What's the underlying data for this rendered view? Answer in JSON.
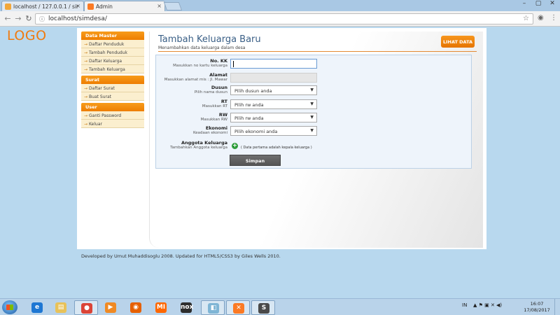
{
  "browser": {
    "tabs": [
      {
        "title": "localhost / 127.0.0.1 / sir",
        "close": "×",
        "active": false
      },
      {
        "title": "Admin",
        "close": "×",
        "active": true
      }
    ],
    "window_controls": [
      "–",
      "▢",
      "✕"
    ],
    "nav": {
      "back": "←",
      "forward": "→",
      "reload": "↻"
    },
    "address": "localhost/simdesa/",
    "info_glyph": "ⓘ",
    "star_glyph": "☆",
    "menu_glyph": "⋮",
    "ext_glyph": "◉"
  },
  "page": {
    "logo": "LOGO",
    "sidebar": {
      "sections": [
        {
          "title": "Data Master",
          "items": [
            "Daftar Penduduk",
            "Tambah Penduduk",
            "Daftar Keluarga",
            "Tambah Keluarga"
          ]
        },
        {
          "title": "Surat",
          "items": [
            "Daftar Surat",
            "Buat Surat"
          ]
        },
        {
          "title": "User",
          "items": [
            "Ganti Password",
            "Keluar"
          ]
        }
      ],
      "arrow": "→"
    },
    "header": {
      "title": "Tambah Keluarga Baru",
      "subtitle": "Menambahkan data keluarga dalam desa",
      "lihat_data": "LIHAT DATA"
    },
    "form": {
      "no_kk": {
        "label": "No. KK",
        "hint": "Masukkan no kartu keluarga",
        "value": ""
      },
      "alamat": {
        "label": "Alamat",
        "hint": "Masukkan alamat mis : Jl. Mawar",
        "value": ""
      },
      "dusun": {
        "label": "Dusun",
        "hint": "Pilih nama dusun",
        "selected": "Pilih dusun anda"
      },
      "rt": {
        "label": "RT",
        "hint": "Masukkan RT",
        "selected": "Pilih rw anda"
      },
      "rw": {
        "label": "RW",
        "hint": "Masukkan RW",
        "selected": "Pilih rw anda"
      },
      "ekonomi": {
        "label": "Ekonomi",
        "hint": "Keadaan ekonomi",
        "selected": "Pilih ekonomi anda"
      },
      "anggota": {
        "label": "Anggota Keluarga",
        "hint": "Tambahkan Anggota keluarga",
        "note": "( Data pertama adalah kepala keluarga )",
        "add_glyph": "+"
      },
      "submit": "Simpan",
      "chevron": "▼"
    },
    "footer": "Developed by Umut Muhaddisoglu 2008. Updated for HTML5/CSS3 by Giles Wells 2010."
  },
  "taskbar": {
    "apps": [
      {
        "name": "internet-explorer",
        "color": "#1e77d3",
        "glyph": "e"
      },
      {
        "name": "file-explorer",
        "color": "#e8c25a",
        "glyph": "▤"
      },
      {
        "name": "chrome",
        "color": "#db4437",
        "glyph": "●"
      },
      {
        "name": "media-player",
        "color": "#f08a24",
        "glyph": "▶"
      },
      {
        "name": "firefox",
        "color": "#e66000",
        "glyph": "◉"
      },
      {
        "name": "mi-app",
        "color": "#ff6700",
        "glyph": "MI"
      },
      {
        "name": "nox-player",
        "color": "#2d2d2d",
        "glyph": "nox"
      },
      {
        "name": "folder-app",
        "color": "#7fb5d5",
        "glyph": "◧"
      },
      {
        "name": "xampp",
        "color": "#fb7a24",
        "glyph": "✕"
      },
      {
        "name": "sublime-text",
        "color": "#4a4a4a",
        "glyph": "S"
      }
    ],
    "tray": {
      "lang": "IN",
      "icons": "▲ ⚑ ▣ ✕ ◀)"
    },
    "time": "16:07",
    "date": "17/08/2017"
  }
}
